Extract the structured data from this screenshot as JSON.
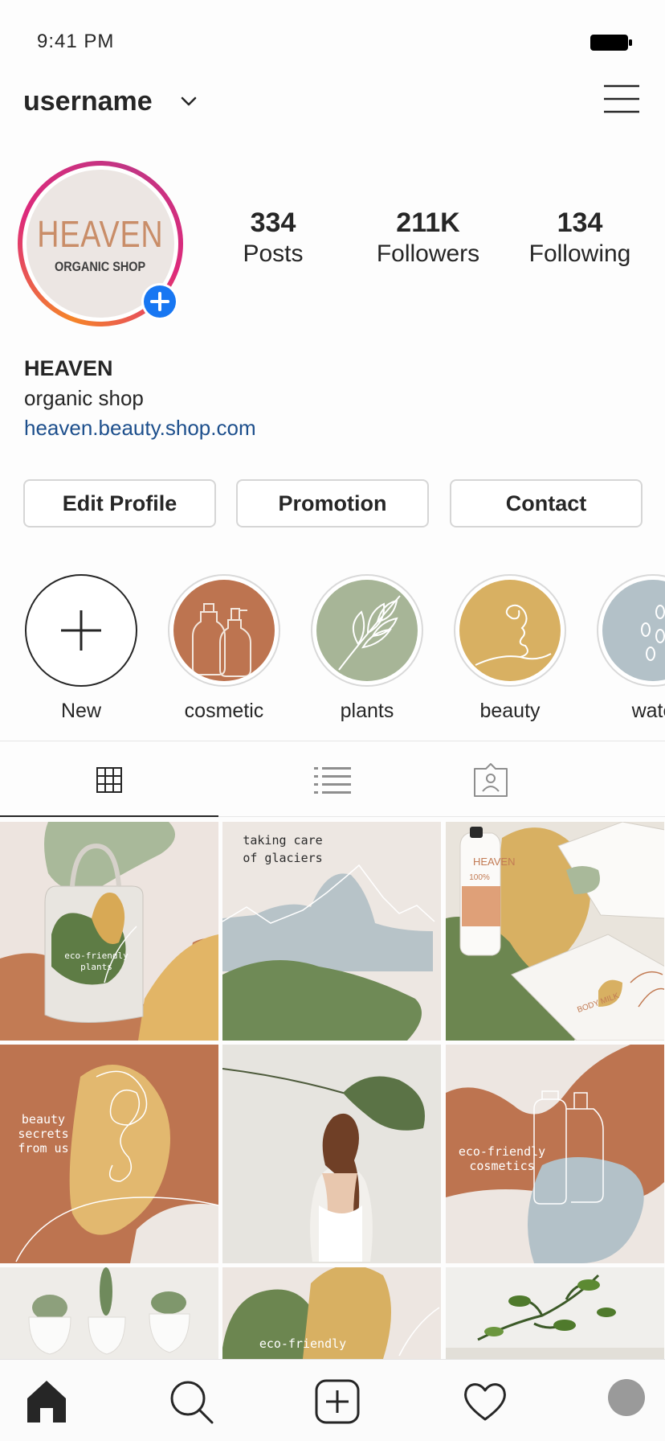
{
  "status_bar": {
    "time": "9:41 PM"
  },
  "header": {
    "username": "username"
  },
  "profile": {
    "logo_main": "HEAVEN",
    "logo_sub": "ORGANIC SHOP",
    "stats": [
      {
        "value": "334",
        "label": "Posts"
      },
      {
        "value": "211K",
        "label": "Followers"
      },
      {
        "value": "134",
        "label": "Following"
      }
    ],
    "name": "HEAVEN",
    "description": "organic shop",
    "link": "heaven.beauty.shop.com"
  },
  "buttons": {
    "edit_profile": "Edit Profile",
    "promotion": "Promotion",
    "contact": "Contact"
  },
  "highlights": [
    {
      "label": "New",
      "color": "#ffffff"
    },
    {
      "label": "cosmetic",
      "color": "#bd7450"
    },
    {
      "label": "plants",
      "color": "#a7b597"
    },
    {
      "label": "beauty",
      "color": "#d8b062"
    },
    {
      "label": "wate",
      "color": "#b3c1c8"
    }
  ],
  "posts": {
    "tile1_text": "eco-friendly plants",
    "tile2_text": [
      "taking care",
      "of glaciers"
    ],
    "tile3_brand": "HEAVEN",
    "tile3_bottle_text": "100%",
    "tile3_box_text": "BODY MILK",
    "tile4_text": [
      "beauty",
      "secrets",
      "from us"
    ],
    "tile6_text": [
      "eco-friendly",
      "cosmetics"
    ],
    "tile8_text": "eco-friendly"
  },
  "colors": {
    "terracotta": "#bd7450",
    "sage": "#a7b597",
    "olive": "#6c8650",
    "mustard": "#d8b062",
    "sky": "#b3c1c8",
    "cream": "#ece6e1",
    "link": "#1d4f8c"
  }
}
